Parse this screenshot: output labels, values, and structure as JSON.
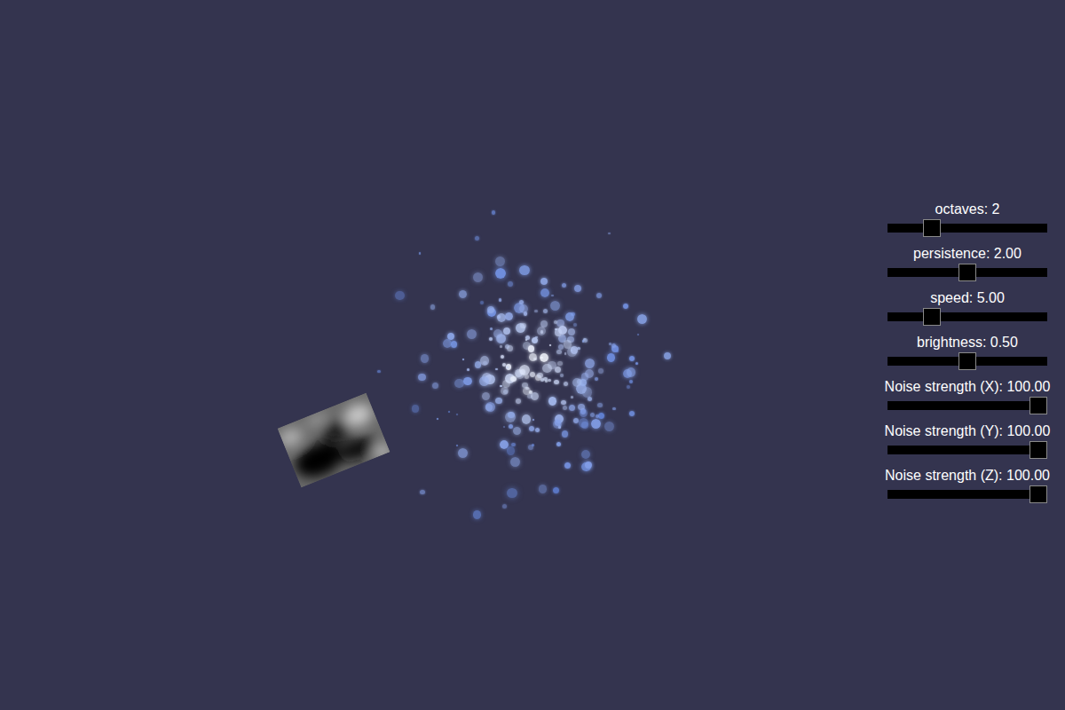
{
  "sliders": [
    {
      "label": "octaves: 2",
      "level": 0.25
    },
    {
      "label": "persistence: 2.00",
      "level": 0.5
    },
    {
      "label": "speed: 5.00",
      "level": 0.25
    },
    {
      "label": "brightness: 0.50",
      "level": 0.5
    },
    {
      "label": "Noise strength (X): 100.00",
      "level": 1
    },
    {
      "label": "Noise strength (Y): 100.00",
      "level": 1
    },
    {
      "label": "Noise strength (Z): 100.00",
      "level": 1
    }
  ]
}
